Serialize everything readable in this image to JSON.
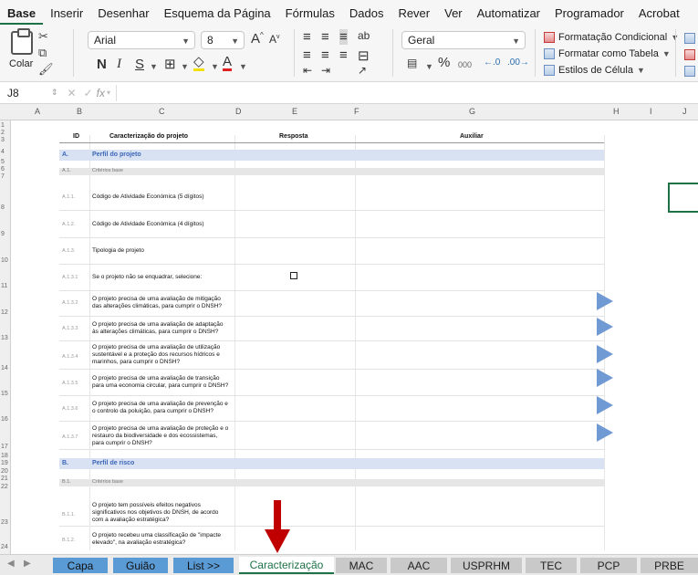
{
  "menu": [
    "Base",
    "Inserir",
    "Desenhar",
    "Esquema da Página",
    "Fórmulas",
    "Dados",
    "Rever",
    "Ver",
    "Automatizar",
    "Programador",
    "Acrobat"
  ],
  "ribbon": {
    "paste_label": "Colar",
    "font_name": "Arial",
    "font_size": "8",
    "number_format": "Geral",
    "cond_format": "Formatação Condicional",
    "format_table": "Formatar como Tabela",
    "cell_styles": "Estilos de Célula",
    "percent": "%",
    "thousands": "000"
  },
  "formula_bar": {
    "name_box": "J8",
    "fx": "fx"
  },
  "columns": [
    "A",
    "B",
    "C",
    "D",
    "E",
    "F",
    "G",
    "H",
    "I",
    "J"
  ],
  "rows": [
    "1",
    "2",
    "3",
    "4",
    "5",
    "6",
    "7",
    "8",
    "9",
    "10",
    "11",
    "12",
    "13",
    "14",
    "15",
    "16",
    "17",
    "18",
    "19",
    "20",
    "21",
    "22",
    "23",
    "24"
  ],
  "table_header": {
    "id": "ID",
    "caracterizacao": "Caracterização do projeto",
    "resposta": "Resposta",
    "auxiliar": "Auxiliar"
  },
  "sections": [
    {
      "code": "A.",
      "title": "Perfil do projeto"
    },
    {
      "code": "B.",
      "title": "Perfil de risco"
    }
  ],
  "subsections": [
    {
      "code": "A.1.",
      "title": "Critérios base"
    },
    {
      "code": "B.1.",
      "title": "Critérios base"
    }
  ],
  "items_a": [
    {
      "code": "A.1.1.",
      "text": "Código de Atividade Económica (5 dígitos)"
    },
    {
      "code": "A.1.2.",
      "text": "Código de Atividade Económica (4 dígitos)"
    },
    {
      "code": "A.1.3.",
      "text": "Tipologia de projeto"
    },
    {
      "code": "A.1.3.1",
      "text": "Se o projeto não se enquadrar, selecione:"
    },
    {
      "code": "A.1.3.2",
      "text": "O projeto precisa de uma avaliação de mitigação das alterações climáticas, para cumprir o DNSH?"
    },
    {
      "code": "A.1.3.3",
      "text": "O projeto precisa de uma avaliação de adaptação às alterações climáticas, para cumprir o DNSH?"
    },
    {
      "code": "A.1.3.4",
      "text": "O projeto precisa de uma avaliação de utilização sustentável e a proteção dos recursos hídricos e marinhos, para cumprir o DNSH?"
    },
    {
      "code": "A.1.3.5",
      "text": "O projeto precisa de uma avaliação de transição para uma economia circular, para cumprir o DNSH?"
    },
    {
      "code": "A.1.3.6",
      "text": "O projeto precisa de uma avaliação de prevenção e o controlo da poluição, para cumprir o DNSH?"
    },
    {
      "code": "A.1.3.7",
      "text": "O projeto precisa de uma avaliação de proteção e o restauro da biodiversidade e dos ecossistemas, para cumprir o DNSH?"
    }
  ],
  "items_b": [
    {
      "code": "B.1.1.",
      "text": "O projeto tem possíveis efeitos negativos significativos nos objetivos do DNSH, de acordo com a avaliação estratégica?"
    },
    {
      "code": "B.1.2.",
      "text": "O projeto recebeu uma classificação de \"impacte elevado\", na avaliação estratégica?"
    }
  ],
  "tabs": [
    "Capa",
    "Guião",
    "List >>",
    "Caracterização",
    "MAC",
    "AAC",
    "USPRHM",
    "TEC",
    "PCP",
    "PRBE"
  ],
  "colors": {
    "accent": "#1e7145",
    "tab_blue": "#5b9bd5",
    "section_fill": "#d9e2f3",
    "arrow_red": "#c00000"
  }
}
